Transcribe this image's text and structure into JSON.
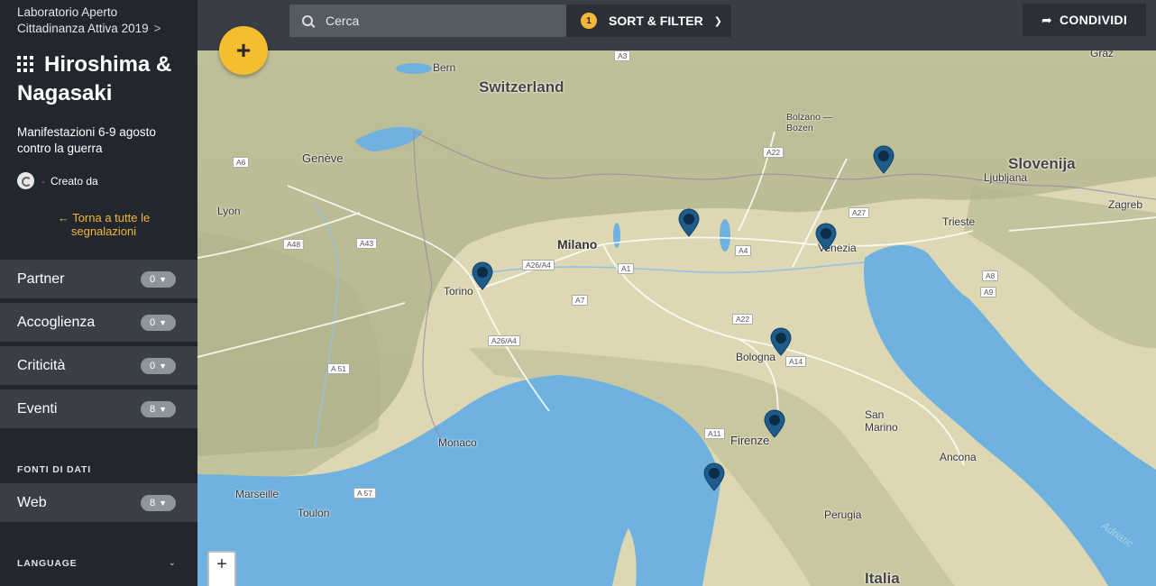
{
  "sidebar": {
    "breadcrumb": "Laboratorio Aperto Cittadinanza Attiva 2019",
    "breadcrumb_arrow": ">",
    "title_line1": "Hiroshima &",
    "title_line2": "Nagasaki",
    "subtitle": "Manifestazioni 6-9 agosto contro la guerra",
    "created_by_sep": "-",
    "created_by": "Creato da",
    "back_link": "← Torna a tutte le segnalazioni",
    "categories": [
      {
        "label": "Partner",
        "count": "0"
      },
      {
        "label": "Accoglienza",
        "count": "0"
      },
      {
        "label": "Criticità",
        "count": "0"
      },
      {
        "label": "Eventi",
        "count": "8"
      }
    ],
    "sources_heading": "FONTI DI DATI",
    "sources": [
      {
        "label": "Web",
        "count": "8"
      }
    ],
    "language_heading": "LANGUAGE"
  },
  "topbar": {
    "search_placeholder": "Cerca",
    "filter_count": "1",
    "filter_label": "SORT & FILTER",
    "share_label": "CONDIVIDI"
  },
  "fab_label": "+",
  "zoom_in_label": "+",
  "map": {
    "countries": [
      "Switzerland",
      "Slovenija",
      "Italia"
    ],
    "cities": [
      "Bern",
      "Genève",
      "Lyon",
      "Milano",
      "Torino",
      "Bolzano — Bozen",
      "Venezia",
      "Trieste",
      "Ljubljana",
      "Zagreb",
      "Graz",
      "Bologna",
      "Firenze",
      "San Marino",
      "Ancona",
      "Perugia",
      "Monaco",
      "Marseille",
      "Toulon"
    ],
    "sea": "Adriatic",
    "roads": [
      "A3",
      "A6",
      "A22",
      "A27",
      "A4",
      "A1",
      "A26/A4",
      "A7",
      "A48",
      "A43",
      "A 51",
      "A 57",
      "A14",
      "A11",
      "A8",
      "A9"
    ],
    "marker_count": 8,
    "colors": {
      "marker": "#1c5b8a",
      "water": "#6fb2e0",
      "land": "#ded8b4",
      "accent": "#f3b73a"
    }
  }
}
